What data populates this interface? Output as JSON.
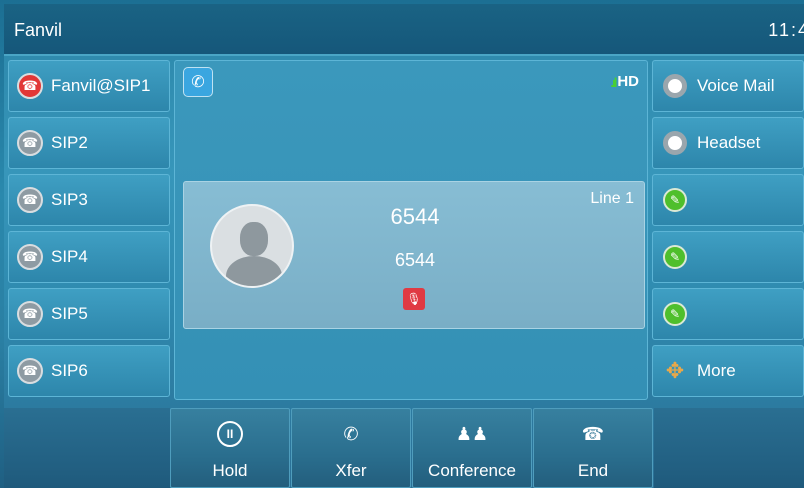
{
  "titlebar": {
    "brand": "Fanvil",
    "clock": "11:4"
  },
  "lines": [
    {
      "label": "Fanvil@SIP1",
      "status": "active-red"
    },
    {
      "label": "SIP2",
      "status": "idle"
    },
    {
      "label": "SIP3",
      "status": "idle"
    },
    {
      "label": "SIP4",
      "status": "idle"
    },
    {
      "label": "SIP5",
      "status": "idle"
    },
    {
      "label": "SIP6",
      "status": "idle"
    }
  ],
  "dss": [
    {
      "label": "Voice Mail",
      "icon": "radio-icon"
    },
    {
      "label": "Headset",
      "icon": "radio-icon"
    },
    {
      "label": "",
      "icon": "edit-icon"
    },
    {
      "label": "",
      "icon": "edit-icon"
    },
    {
      "label": "",
      "icon": "edit-icon"
    },
    {
      "label": "More",
      "icon": "arrows-icon"
    }
  ],
  "call": {
    "number": "6544",
    "name": "6544",
    "line": "Line 1",
    "hd": "HD",
    "muted": true
  },
  "softkeys": [
    {
      "label": "Hold",
      "icon": "pause-icon"
    },
    {
      "label": "Xfer",
      "icon": "transfer-icon"
    },
    {
      "label": "Conference",
      "icon": "conference-icon"
    },
    {
      "label": "End",
      "icon": "hangup-icon"
    }
  ],
  "colors": {
    "accent": "#2f8bb0",
    "line_active": "#e23737",
    "mute": "#e03a43",
    "dss_green": "#4fbf2c",
    "signal": "#49d132"
  }
}
